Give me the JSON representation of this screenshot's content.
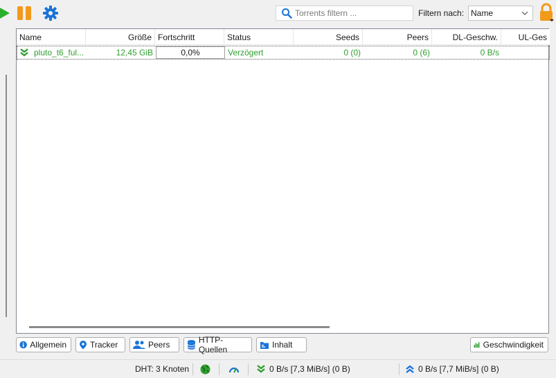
{
  "toolbar": {
    "search_placeholder": "Torrents filtern ...",
    "filter_label": "Filtern nach:",
    "filter_value": "Name"
  },
  "table": {
    "columns": [
      "Name",
      "Größe",
      "Fortschritt",
      "Status",
      "Seeds",
      "Peers",
      "DL-Geschw.",
      "UL-Ges"
    ],
    "rows": [
      {
        "name": "pluto_t6_ful...",
        "size": "12,45 GiB",
        "progress": "0,0%",
        "status": "Verzögert",
        "seeds": "0 (0)",
        "peers": "0 (6)",
        "dl_speed": "0 B/s",
        "ul_speed": ""
      }
    ]
  },
  "tabs": {
    "general": "Allgemein",
    "tracker": "Tracker",
    "peers": "Peers",
    "http_sources": "HTTP-Quellen",
    "content": "Inhalt",
    "speed": "Geschwindigkeit"
  },
  "status": {
    "dht": "DHT: 3 Knoten",
    "download": "0 B/s [7,3 MiB/s] (0 B)",
    "upload": "0 B/s [7,7 MiB/s] (0 B)"
  },
  "colors": {
    "accent_blue": "#1a74d8",
    "status_green": "#2e9e2e",
    "pause_orange": "#f29a1b"
  }
}
